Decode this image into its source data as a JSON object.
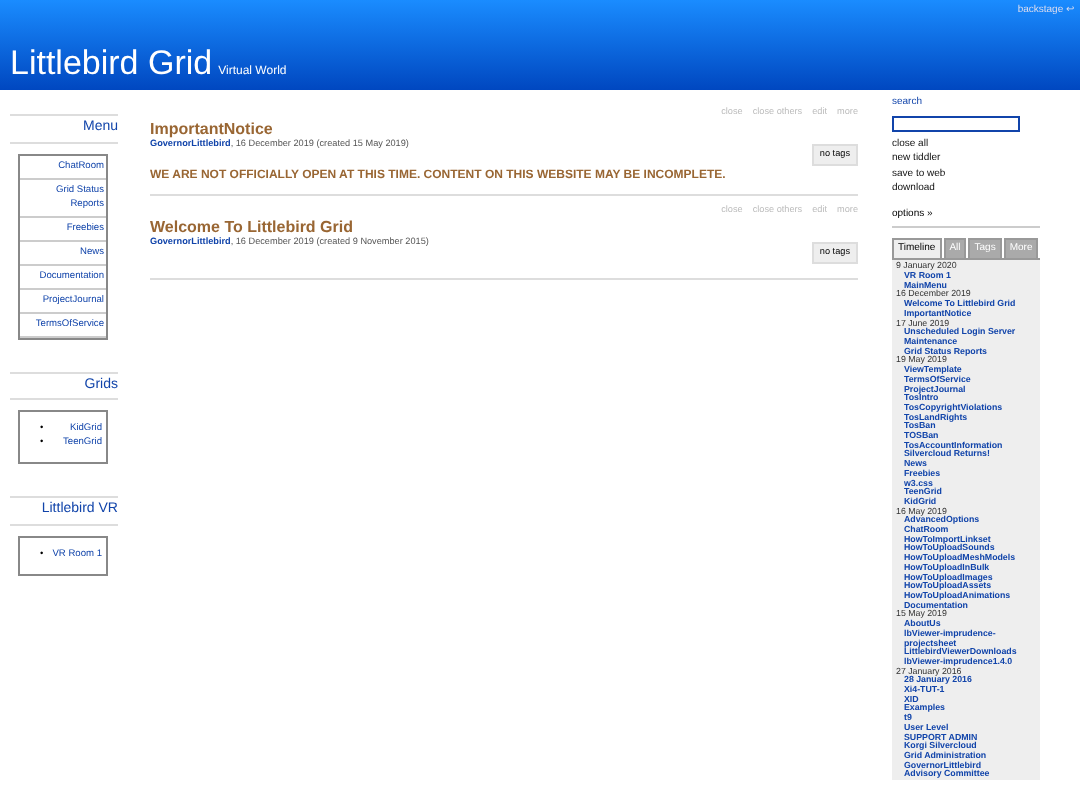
{
  "backstage": "backstage ↩",
  "site": {
    "title": "Littlebird Grid",
    "subtitle": "Virtual World"
  },
  "sidebar": [
    {
      "heading": "Menu",
      "kind": "boxed",
      "items": [
        "ChatRoom",
        "Grid Status Reports",
        "Freebies",
        "News",
        "Documentation",
        "ProjectJournal",
        "TermsOfService"
      ]
    },
    {
      "heading": "Grids",
      "kind": "bulleted",
      "marker": "•",
      "items": [
        "KidGrid",
        "TeenGrid"
      ]
    },
    {
      "heading": "Littlebird VR",
      "kind": "bulleted",
      "marker": "•",
      "items": [
        "VR Room 1"
      ]
    }
  ],
  "tiddlers": [
    {
      "toolbar": [
        "close",
        "close others",
        "edit",
        "more"
      ],
      "title": "ImportantNotice",
      "modifier": "GovernorLittlebird",
      "subtitle": ", 16 December 2019 (created 15 May 2019)",
      "tags": "no tags",
      "body": "WE ARE NOT OFFICIALLY OPEN AT THIS TIME. CONTENT ON THIS WEBSITE MAY BE INCOMPLETE."
    },
    {
      "toolbar": [
        "close",
        "close others",
        "edit",
        "more"
      ],
      "title": "Welcome To Littlebird Grid",
      "modifier": "GovernorLittlebird",
      "subtitle": ", 16 December 2019 (created 9 November 2015)",
      "tags": "no tags"
    }
  ],
  "side_options": {
    "search_label": "search",
    "commands": [
      "close all",
      "new tiddler",
      "save to web",
      "download"
    ],
    "options": "options »"
  },
  "tabs": [
    {
      "label": "Timeline",
      "selected": true
    },
    {
      "label": "All",
      "selected": false
    },
    {
      "label": "Tags",
      "selected": false
    },
    {
      "label": "More",
      "selected": false
    }
  ],
  "timeline": [
    {
      "date": "9 January 2020",
      "items": [
        "VR Room 1",
        "MainMenu"
      ]
    },
    {
      "date": "16 December 2019",
      "items": [
        "Welcome To Littlebird Grid",
        "ImportantNotice"
      ]
    },
    {
      "date": "17 June 2019",
      "items": [
        "Unscheduled Login Server Maintenance",
        "Grid Status Reports"
      ]
    },
    {
      "date": "19 May 2019",
      "items": [
        "ViewTemplate",
        "TermsOfService",
        "ProjectJournal",
        "TosIntro",
        "TosCopyrightViolations",
        "TosLandRights",
        "TosBan",
        "TOSBan",
        "TosAccountInformation",
        "Silvercloud Returns!",
        "News",
        "Freebies",
        "w3.css",
        "TeenGrid",
        "KidGrid"
      ]
    },
    {
      "date": "16 May 2019",
      "items": [
        "AdvancedOptions",
        "ChatRoom",
        "HowToImportLinkset",
        "HowToUploadSounds",
        "HowToUploadMeshModels",
        "HowToUploadInBulk",
        "HowToUploadImages",
        "HowToUploadAssets",
        "HowToUploadAnimations",
        "Documentation"
      ]
    },
    {
      "date": "15 May 2019",
      "items": [
        "AboutUs",
        "lbViewer-imprudence-projectsheet",
        "LittlebirdViewerDownloads",
        "lbViewer-imprudence1.4.0"
      ]
    },
    {
      "date": "27 January 2016",
      "items": [
        "28 January 2016",
        "Xi4-TUT-1",
        "XID",
        "Examples",
        "t9",
        "User Level",
        "SUPPORT ADMIN",
        "Korgi Silvercloud",
        "Grid Administration",
        "GovernorLittlebird",
        "Advisory Committee"
      ]
    }
  ]
}
